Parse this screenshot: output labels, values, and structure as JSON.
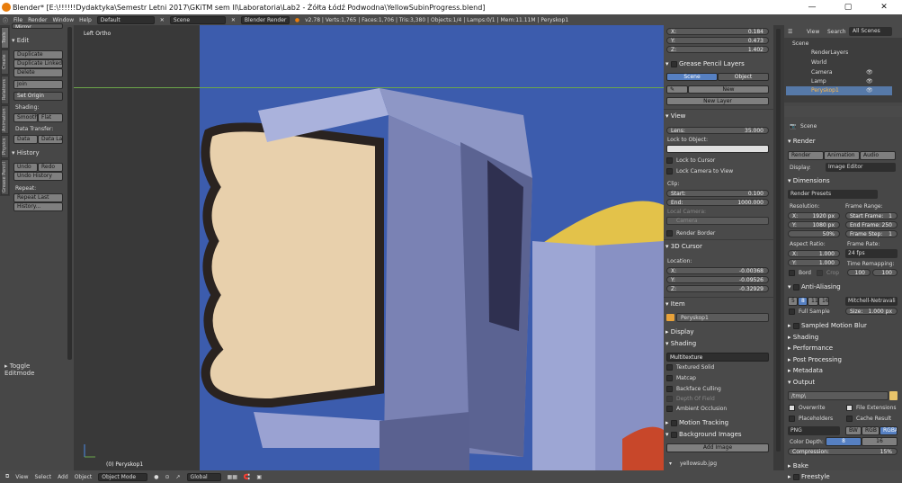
{
  "window": {
    "title": "Blender* [E:\\!!!!!!Dydaktyka\\Semestr Letni 2017\\GKiTM sem II\\Laboratoria\\Lab2 - Żółta Łódź Podwodna\\YellowSubinProgress.blend]",
    "minimize": "—",
    "maximize": "▢",
    "close": "✕"
  },
  "topbar": {
    "menus": [
      "File",
      "Render",
      "Window",
      "Help"
    ],
    "layout": "Default",
    "scene": "Scene",
    "engine": "Blender Render",
    "stats": "v2.78 | Verts:1,765 | Faces:1,706 | Tris:3,380 | Objects:1/4 | Lamps:0/1 | Mem:11.11M | Peryskop1"
  },
  "tool_tabs": [
    "Tools",
    "Create",
    "Relations",
    "Animation",
    "Physics",
    "Grease Pencil"
  ],
  "tools": {
    "mirror": "Mirror",
    "edit_header": "Edit",
    "duplicate": "Duplicate",
    "duplicate_linked": "Duplicate Linked",
    "delete": "Delete",
    "join": "Join",
    "set_origin": "Set Origin",
    "shading_label": "Shading:",
    "smooth": "Smooth",
    "flat": "Flat",
    "data_transfer_label": "Data Transfer:",
    "data": "Data",
    "data_la": "Data La",
    "history_header": "History",
    "undo": "Undo",
    "redo": "Redo",
    "undo_history": "Undo History",
    "repeat_label": "Repeat:",
    "repeat_last": "Repeat Last",
    "history": "History...",
    "toggle_editmode": "Toggle Editmode"
  },
  "viewport": {
    "view_name": "Left Ortho",
    "object_label": "(0) Peryskop1"
  },
  "bottom_header": {
    "view": "View",
    "select": "Select",
    "add": "Add",
    "object": "Object",
    "mode": "Object Mode",
    "orientation": "Global"
  },
  "npanel": {
    "x_label": "X:",
    "x": "0.184",
    "y_label": "Y:",
    "y": "0.473",
    "z_label": "Z:",
    "z": "1.402",
    "gp_header": "Grease Pencil Layers",
    "scene_btn": "Scene",
    "object_btn": "Object",
    "new": "New",
    "new_layer": "New Layer",
    "view_header": "View",
    "lens_label": "Lens:",
    "lens": "35.000",
    "lock_to_object": "Lock to Object:",
    "lock_to_cursor": "Lock to Cursor",
    "lock_camera": "Lock Camera to View",
    "clip": "Clip:",
    "start_label": "Start:",
    "start": "0.100",
    "end_label": "End:",
    "end": "1000.000",
    "local_camera": "Local Camera:",
    "camera": "Camera",
    "render_border": "Render Border",
    "cursor_header": "3D Cursor",
    "location": "Location:",
    "cx": "-0.00368",
    "cy": "-0.09526",
    "cz": "-0.32929",
    "item_header": "Item",
    "item_name": "Peryskop1",
    "display_header": "Display",
    "shading_header": "Shading",
    "multitexture": "Multitexture",
    "textured_solid": "Textured Solid",
    "matcap": "Matcap",
    "backface": "Backface Culling",
    "depth_of_field": "Depth Of Field",
    "ambient": "Ambient Occlusion",
    "motion_tracking": "Motion Tracking",
    "background_images": "Background Images",
    "add_image": "Add Image",
    "image_file": "yellowsub.jpg"
  },
  "outliner": {
    "view": "View",
    "search": "Search",
    "all_scenes": "All Scenes",
    "items": [
      "Scene",
      "RenderLayers",
      "World",
      "Camera",
      "Lamp",
      "Peryskop1"
    ]
  },
  "properties": {
    "scene": "Scene",
    "render_header": "Render",
    "render": "Render",
    "animation": "Animation",
    "audio": "Audio",
    "display_label": "Display:",
    "display": "Image Editor",
    "dimensions": "Dimensions",
    "render_presets": "Render Presets",
    "resolution": "Resolution:",
    "res_x": "1920 px",
    "res_y": "1080 px",
    "res_pct": "50%",
    "frame_range": "Frame Range:",
    "start_frame": "Start Frame:",
    "start_frame_v": "1",
    "end_frame": "End Frame:",
    "end_frame_v": "250",
    "frame_step": "Frame Step:",
    "frame_step_v": "1",
    "aspect_ratio": "Aspect Ratio:",
    "asp_x": "1.000",
    "asp_y": "1.000",
    "frame_rate": "Frame Rate:",
    "fps": "24 fps",
    "time_remap": "Time Remapping:",
    "tr_old": "100",
    "tr_new": "100",
    "bord": "Bord",
    "crop": "Crop",
    "anti_aliasing": "Anti-Aliasing",
    "aa_vals": [
      "5",
      "8",
      "11",
      "16"
    ],
    "aa_filter": "Mitchell-Netravali",
    "full_sample": "Full Sample",
    "size_label": "Size:",
    "size": "1.000 px",
    "sampled_motion_blur": "Sampled Motion Blur",
    "shading": "Shading",
    "performance": "Performance",
    "post_processing": "Post Processing",
    "metadata": "Metadata",
    "output": "Output",
    "tmp": "/tmp\\",
    "overwrite": "Overwrite",
    "file_ext": "File Extensions",
    "placeholders": "Placeholders",
    "cache_result": "Cache Result",
    "format": "PNG",
    "bw": "BW",
    "rgb": "RGB",
    "rgba": "RGBA",
    "color_depth": "Color Depth:",
    "cd8": "8",
    "cd16": "16",
    "compression": "Compression:",
    "compression_v": "15%",
    "bake": "Bake",
    "freestyle": "Freestyle"
  }
}
